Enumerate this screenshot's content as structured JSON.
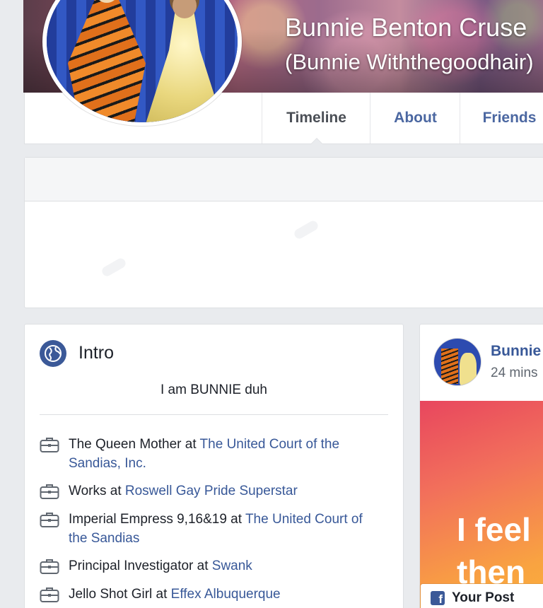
{
  "profile": {
    "name": "Bunnie Benton Cruse",
    "alternate_name": "(Bunnie Withthegoodhair)"
  },
  "nav": {
    "tabs": [
      {
        "label": "Timeline",
        "active": true
      },
      {
        "label": "About",
        "active": false
      },
      {
        "label": "Friends",
        "active": false
      }
    ]
  },
  "intro": {
    "title": "Intro",
    "bio": "I am BUNNIE duh",
    "work": [
      {
        "role": "The Queen Mother at ",
        "org": "The United Court of the Sandias, Inc."
      },
      {
        "role": "Works at ",
        "org": "Roswell Gay Pride Superstar"
      },
      {
        "role": "Imperial Empress 9,16&19 at ",
        "org": "The United Court of the Sandias"
      },
      {
        "role": "Principal Investigator at ",
        "org": "Swank"
      },
      {
        "role": "Jello Shot Girl at ",
        "org": "Effex Albuquerque"
      }
    ]
  },
  "post": {
    "author": "Bunnie",
    "time": "24 mins",
    "image_text_line1": "I feel",
    "image_text_line2": "then",
    "badge_label": "Your Post"
  },
  "colors": {
    "page_bg": "#e9ebee",
    "link": "#385898",
    "tab_link": "#4b67a1",
    "brand": "#3b5998"
  }
}
